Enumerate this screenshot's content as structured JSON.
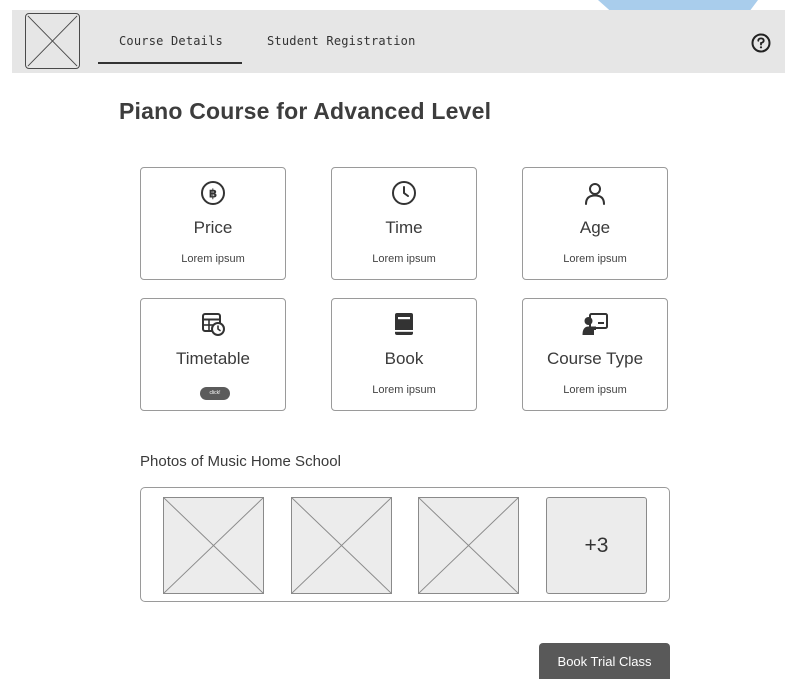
{
  "nav": {
    "tabs": [
      {
        "label": "Course Details"
      },
      {
        "label": "Student Registration"
      }
    ],
    "active_tab": "Course Details"
  },
  "main": {
    "title": "Piano Course for Advanced Level",
    "cards": [
      {
        "title": "Price",
        "text": "Lorem ipsum",
        "icon": "baht-coin-icon"
      },
      {
        "title": "Time",
        "text": "Lorem ipsum",
        "icon": "clock-icon"
      },
      {
        "title": "Age",
        "text": "Lorem ipsum",
        "icon": "user-icon"
      },
      {
        "title": "Timetable",
        "button": "click!",
        "icon": "calendar-clock-icon"
      },
      {
        "title": "Book",
        "text": "Lorem ipsum",
        "icon": "book-icon"
      },
      {
        "title": "Course Type",
        "text": "Lorem ipsum",
        "icon": "presentation-icon"
      }
    ],
    "photos": {
      "title": "Photos of Music Home School",
      "more_label": "+3"
    },
    "cta_label": "Book Trial Class"
  },
  "colors": {
    "topbar": "#e6e6e6",
    "accent": "#a9cdec",
    "button": "#595959"
  }
}
